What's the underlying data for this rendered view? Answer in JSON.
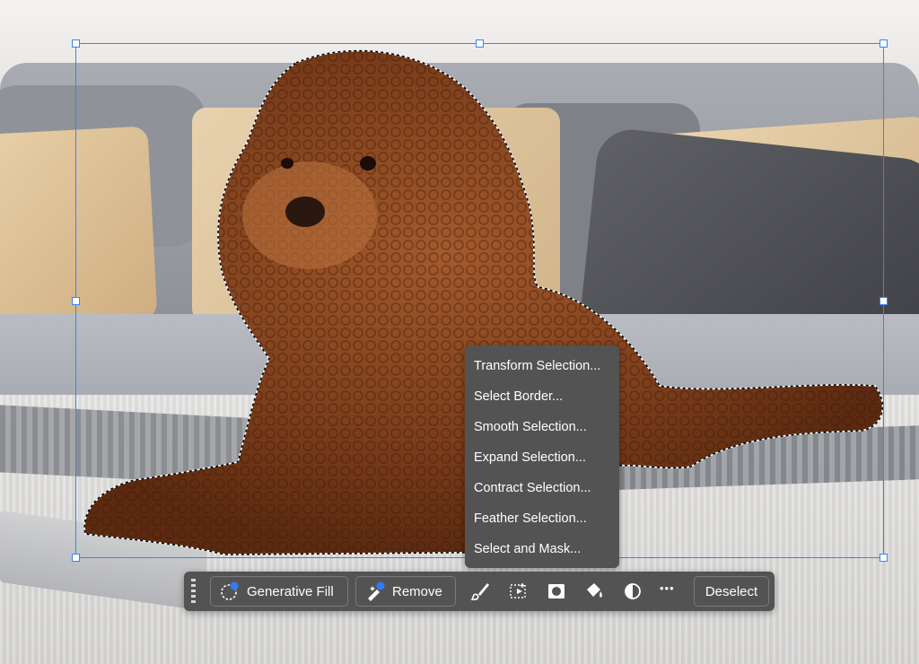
{
  "context_menu": {
    "items": [
      {
        "label": "Transform Selection..."
      },
      {
        "label": "Select Border..."
      },
      {
        "label": "Smooth Selection..."
      },
      {
        "label": "Expand Selection..."
      },
      {
        "label": "Contract Selection..."
      },
      {
        "label": "Feather Selection..."
      },
      {
        "label": "Select and Mask..."
      }
    ]
  },
  "taskbar": {
    "generative_fill_label": "Generative Fill",
    "remove_label": "Remove",
    "deselect_label": "Deselect",
    "more_label": "•••",
    "icons": [
      "generative-fill-icon",
      "remove-icon",
      "brush-icon",
      "transform-icon",
      "mask-icon",
      "fill-bucket-icon",
      "adjustment-icon",
      "more-icon"
    ]
  },
  "colors": {
    "selection": "#3b82f6",
    "bar_bg": "#535353",
    "accent": "#2f7bf6"
  }
}
